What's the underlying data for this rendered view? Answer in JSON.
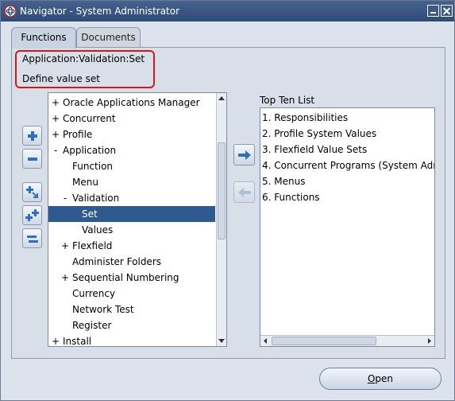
{
  "window": {
    "title": "Navigator - System Administrator",
    "icon": "oracle-apps-icon"
  },
  "tabs": [
    {
      "label": "Functions",
      "active": true
    },
    {
      "label": "Documents",
      "active": false
    }
  ],
  "prompt": {
    "path": "Application:Validation:Set",
    "description": "Define value set"
  },
  "side_buttons": [
    {
      "name": "expand-icon"
    },
    {
      "name": "collapse-icon"
    },
    {
      "name": "expand-branch-icon"
    },
    {
      "name": "expand-all-icon"
    },
    {
      "name": "collapse-all-icon"
    }
  ],
  "tree": {
    "items": [
      {
        "expander": "+",
        "label": "Oracle Applications Manager",
        "level": 0
      },
      {
        "expander": "+",
        "label": "Concurrent",
        "level": 0
      },
      {
        "expander": "+",
        "label": "Profile",
        "level": 0
      },
      {
        "expander": "-",
        "label": "Application",
        "level": 0
      },
      {
        "expander": "",
        "label": "Function",
        "level": 1
      },
      {
        "expander": "",
        "label": "Menu",
        "level": 1
      },
      {
        "expander": "-",
        "label": "Validation",
        "level": 1
      },
      {
        "expander": "",
        "label": "Set",
        "level": 2,
        "selected": true
      },
      {
        "expander": "",
        "label": "Values",
        "level": 2
      },
      {
        "expander": "+",
        "label": "Flexfield",
        "level": 1
      },
      {
        "expander": "",
        "label": "Administer Folders",
        "level": 1
      },
      {
        "expander": "+",
        "label": "Sequential Numbering",
        "level": 1
      },
      {
        "expander": "",
        "label": "Currency",
        "level": 1
      },
      {
        "expander": "",
        "label": "Network Test",
        "level": 1
      },
      {
        "expander": "",
        "label": "Register",
        "level": 1
      },
      {
        "expander": "+",
        "label": "Install",
        "level": 0
      }
    ]
  },
  "transfer": {
    "add_icon": "arrow-right-icon",
    "remove_icon": "arrow-left-icon"
  },
  "top_ten": {
    "label": "Top Ten List",
    "items": [
      "1. Responsibilities",
      "2. Profile System Values",
      "3. Flexfield Value Sets",
      "4. Concurrent Programs (System Adn",
      "5. Menus",
      "6. Functions"
    ]
  },
  "open_button": {
    "label_first": "O",
    "label_rest": "pen"
  },
  "colors": {
    "selection": "#2f5a8f",
    "highlight_border": "#d21a1a",
    "titlebar": "#3b5a8a"
  }
}
